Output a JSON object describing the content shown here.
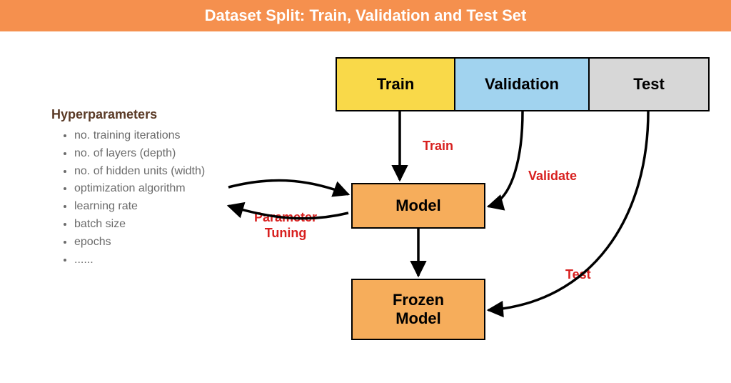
{
  "header": {
    "title": "Dataset Split: Train, Validation and Test Set"
  },
  "splits": {
    "train": "Train",
    "validation": "Validation",
    "test": "Test"
  },
  "nodes": {
    "model": "Model",
    "frozen": "Frozen\nModel"
  },
  "edges": {
    "train_label": "Train",
    "validate_label": "Validate",
    "test_label": "Test",
    "tuning_label": "Parameter\nTuning"
  },
  "hyperparameters": {
    "title": "Hyperparameters",
    "items": [
      "no. training iterations",
      "no. of layers (depth)",
      "no. of hidden units (width)",
      "optimization algorithm",
      "learning rate",
      "batch size",
      "epochs",
      "......"
    ]
  },
  "colors": {
    "header_bg": "#f5904e",
    "train_bg": "#f9d949",
    "validation_bg": "#a1d3ef",
    "test_bg": "#d7d7d7",
    "model_bg": "#f6ad5b",
    "edge_label": "#d8201f",
    "hyper_title": "#5a3a26",
    "hyper_text": "#6b6b6b"
  }
}
